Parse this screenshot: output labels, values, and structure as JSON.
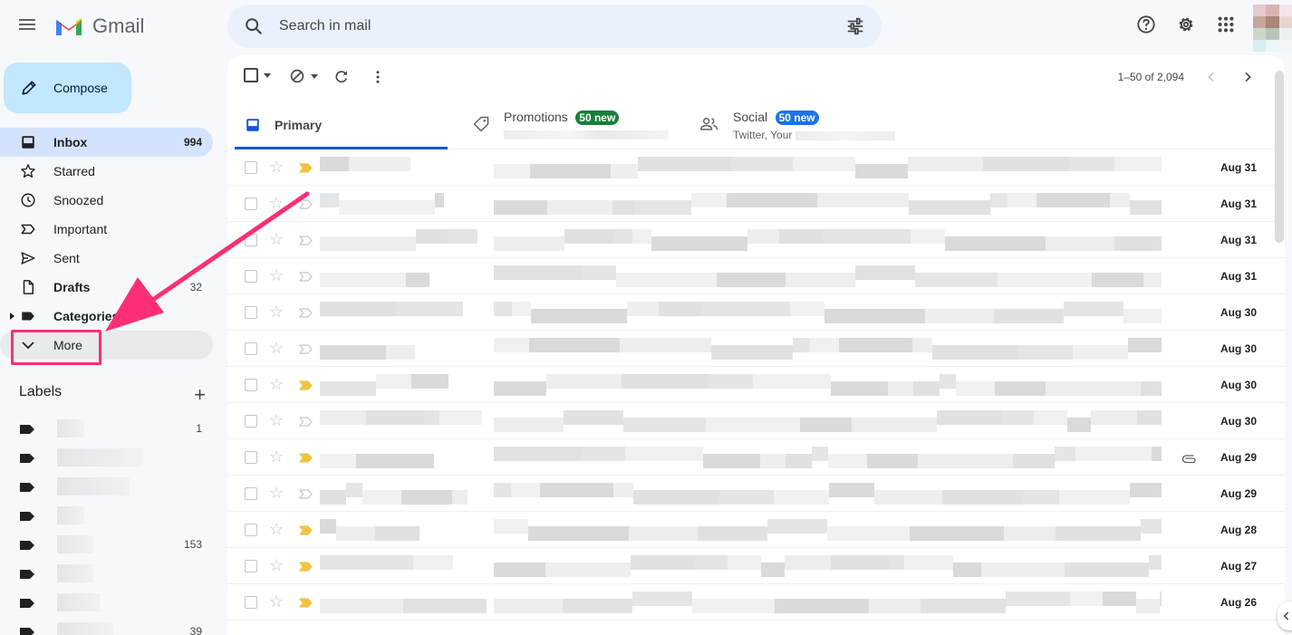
{
  "app": {
    "logo_text": "Gmail"
  },
  "search": {
    "placeholder": "Search in mail"
  },
  "compose": {
    "label": "Compose"
  },
  "nav": {
    "inbox": {
      "label": "Inbox",
      "count": "994"
    },
    "starred": {
      "label": "Starred"
    },
    "snoozed": {
      "label": "Snoozed"
    },
    "important": {
      "label": "Important"
    },
    "sent": {
      "label": "Sent"
    },
    "drafts": {
      "label": "Drafts",
      "count": "32"
    },
    "categories": {
      "label": "Categories"
    },
    "more": {
      "label": "More"
    }
  },
  "labels": {
    "title": "Labels",
    "items": [
      {
        "count": "1"
      },
      {
        "count": ""
      },
      {
        "count": ""
      },
      {
        "count": ""
      },
      {
        "count": "153"
      },
      {
        "count": ""
      },
      {
        "count": ""
      },
      {
        "count": "39"
      }
    ]
  },
  "toolbar": {
    "pager_text": "1–50 of 2,094"
  },
  "tabs": {
    "primary": {
      "label": "Primary"
    },
    "promotions": {
      "label": "Promotions",
      "badge": "50 new"
    },
    "social": {
      "label": "Social",
      "badge": "50 new",
      "snippet_prefix": "Twitter, Your"
    }
  },
  "colors": {
    "accent": "#0b57d0",
    "promotions_badge": "#188038",
    "social_badge": "#1a73e8",
    "important_marker": "#f2c341",
    "annotation": "#ff2e76"
  },
  "emails": [
    {
      "date": "Aug 31",
      "important": true,
      "attachment": false
    },
    {
      "date": "Aug 31",
      "important": false,
      "attachment": false
    },
    {
      "date": "Aug 31",
      "important": false,
      "attachment": false
    },
    {
      "date": "Aug 31",
      "important": false,
      "attachment": false
    },
    {
      "date": "Aug 30",
      "important": false,
      "attachment": false
    },
    {
      "date": "Aug 30",
      "important": false,
      "attachment": false
    },
    {
      "date": "Aug 30",
      "important": true,
      "attachment": false
    },
    {
      "date": "Aug 30",
      "important": false,
      "attachment": false
    },
    {
      "date": "Aug 29",
      "important": true,
      "attachment": true
    },
    {
      "date": "Aug 29",
      "important": false,
      "attachment": false
    },
    {
      "date": "Aug 28",
      "important": true,
      "attachment": false
    },
    {
      "date": "Aug 27",
      "important": true,
      "attachment": false
    },
    {
      "date": "Aug 26",
      "important": true,
      "attachment": false
    }
  ]
}
